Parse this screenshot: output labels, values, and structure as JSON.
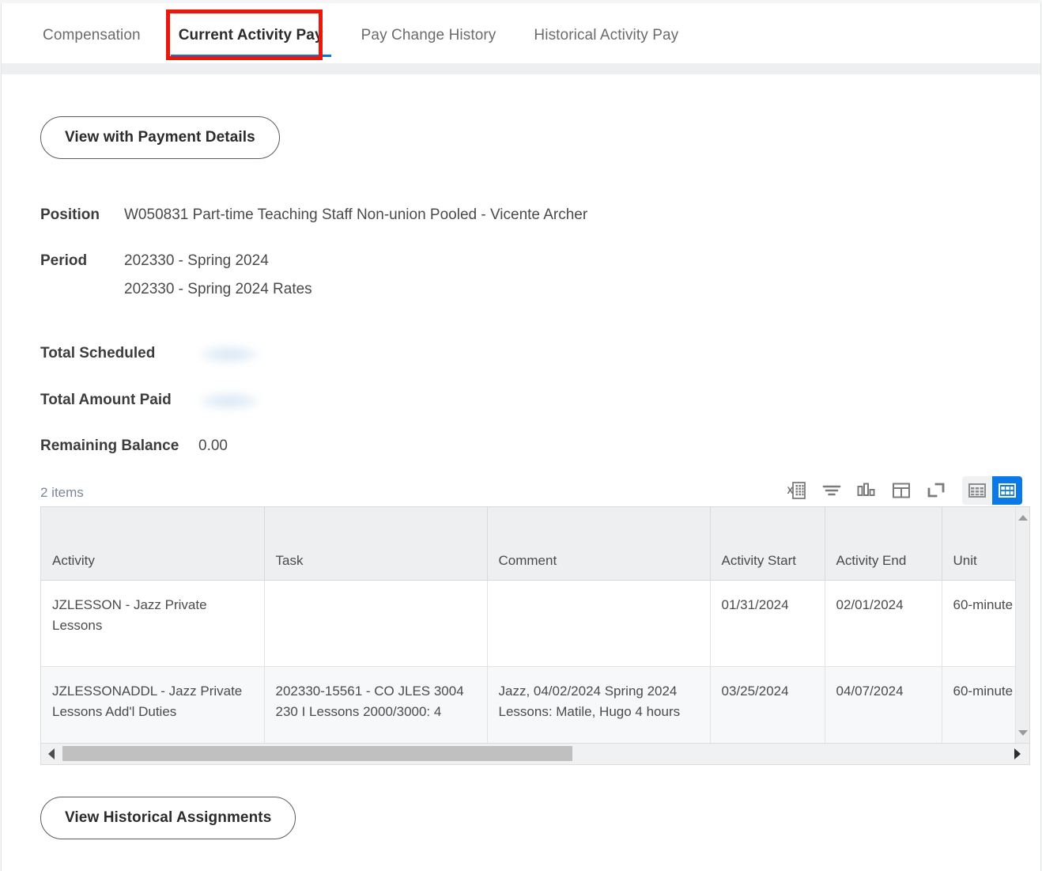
{
  "tabs": [
    {
      "label": "Compensation",
      "active": false
    },
    {
      "label": "Current Activity Pay",
      "active": true
    },
    {
      "label": "Pay Change History",
      "active": false
    },
    {
      "label": "Historical Activity Pay",
      "active": false
    }
  ],
  "buttons": {
    "view_payment_details": "View with Payment Details",
    "view_historical_assignments": "View Historical Assignments"
  },
  "fields": {
    "position_label": "Position",
    "position_value": "W050831 Part-time Teaching Staff Non-union Pooled - Vicente Archer",
    "period_label": "Period",
    "period_value_1": "202330 - Spring 2024",
    "period_value_2": "202330 - Spring 2024 Rates",
    "total_scheduled_label": "Total Scheduled",
    "total_scheduled_value": "",
    "total_amount_paid_label": "Total Amount Paid",
    "total_amount_paid_value": "",
    "remaining_balance_label": "Remaining Balance",
    "remaining_balance_value": "0.00"
  },
  "grid": {
    "items_count": "2 items",
    "toolbar": [
      {
        "name": "export-to-excel-icon",
        "title": "Export to Excel"
      },
      {
        "name": "filter-icon",
        "title": "Filter"
      },
      {
        "name": "chart-icon",
        "title": "Chart View"
      },
      {
        "name": "toggle-panel-icon",
        "title": "Toggle Panel"
      },
      {
        "name": "expand-icon",
        "title": "Expand"
      }
    ],
    "view_toggle": [
      {
        "name": "grid-view-icon",
        "active": false
      },
      {
        "name": "table-view-icon",
        "active": true
      }
    ],
    "columns": [
      "Activity",
      "Task",
      "Comment",
      "Activity Start",
      "Activity End",
      "Unit",
      ""
    ],
    "rows": [
      {
        "activity": "JZLESSON - Jazz Private Lessons",
        "task": "",
        "comment": "",
        "activity_start": "01/31/2024",
        "activity_end": "02/01/2024",
        "unit": "60-minute",
        "extra": ""
      },
      {
        "activity": "JZLESSONADDL - Jazz Private Lessons Add'l Duties",
        "task": "202330-15561 - CO JLES 3004 230 I Lessons 2000/3000: 4",
        "comment": "Jazz, 04/02/2024 Spring 2024 Lessons: Matile, Hugo 4 hours",
        "activity_start": "03/25/2024",
        "activity_end": "04/07/2024",
        "unit": "60-minute",
        "extra": ""
      }
    ]
  },
  "colors": {
    "accent_blue": "#0b79e8",
    "tab_underline": "#0875e1",
    "highlight_red": "#e8180c",
    "header_bg": "#eeeff1",
    "page_bg": "#ffffff"
  }
}
